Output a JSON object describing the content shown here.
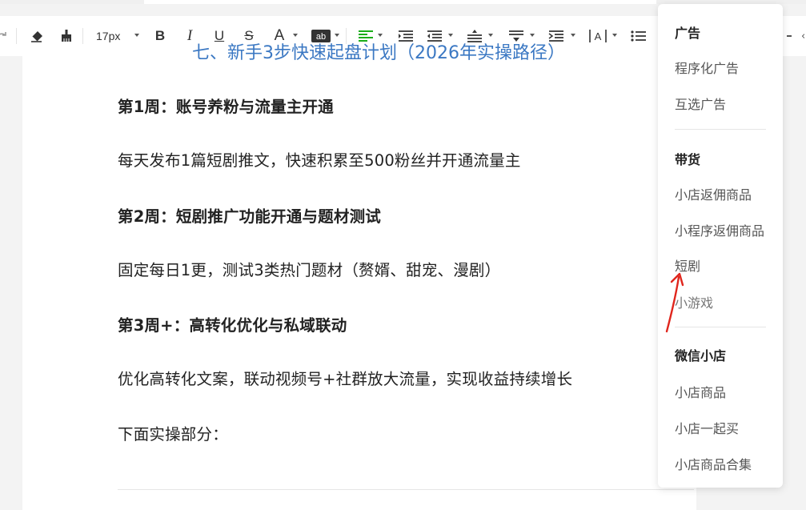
{
  "toolbar": {
    "font_size": "17px",
    "icons": [
      "redo-icon",
      "clear-format-icon",
      "format-painter-icon",
      "bold-icon",
      "italic-icon",
      "underline-icon",
      "strikethrough-icon",
      "font-color-icon",
      "highlight-icon",
      "align-left-icon",
      "indent-icon",
      "outdent-icon",
      "line-height-icon",
      "paragraph-spacing-icon",
      "list-indent-icon",
      "letter-spacing-icon",
      "bullet-list-icon"
    ],
    "accent": "#1aad19"
  },
  "document": {
    "heading": "七、新手3步快速起盘计划（2026年实操路径）",
    "paragraphs": [
      {
        "text": "第1周：账号养粉与流量主开通",
        "bold": true
      },
      {
        "text": "每天发布1篇短剧推文，快速积累至500粉丝并开通流量主",
        "bold": false
      },
      {
        "text": "第2周：短剧推广功能开通与题材测试",
        "bold": true
      },
      {
        "text": "固定每日1更，测试3类热门题材（赘婿、甜宠、漫剧）",
        "bold": false
      },
      {
        "text": "第3周+：高转化优化与私域联动",
        "bold": true
      },
      {
        "text": "优化高转化文案，联动视频号+社群放大流量，实现收益持续增长",
        "bold": false
      },
      {
        "text": "下面实操部分：",
        "bold": false
      }
    ],
    "heading_color": "#3b78c3"
  },
  "dropdown": {
    "sections": [
      {
        "title": "广告",
        "items": [
          "程序化广告",
          "互选广告"
        ]
      },
      {
        "title": "带货",
        "items": [
          "小店返佣商品",
          "小程序返佣商品",
          "短剧",
          "小游戏"
        ]
      },
      {
        "title": "微信小店",
        "items": [
          "小店商品",
          "小店一起买",
          "小店商品合集"
        ]
      }
    ],
    "highlighted_item": "短剧",
    "annotation_color": "#e0261d"
  }
}
